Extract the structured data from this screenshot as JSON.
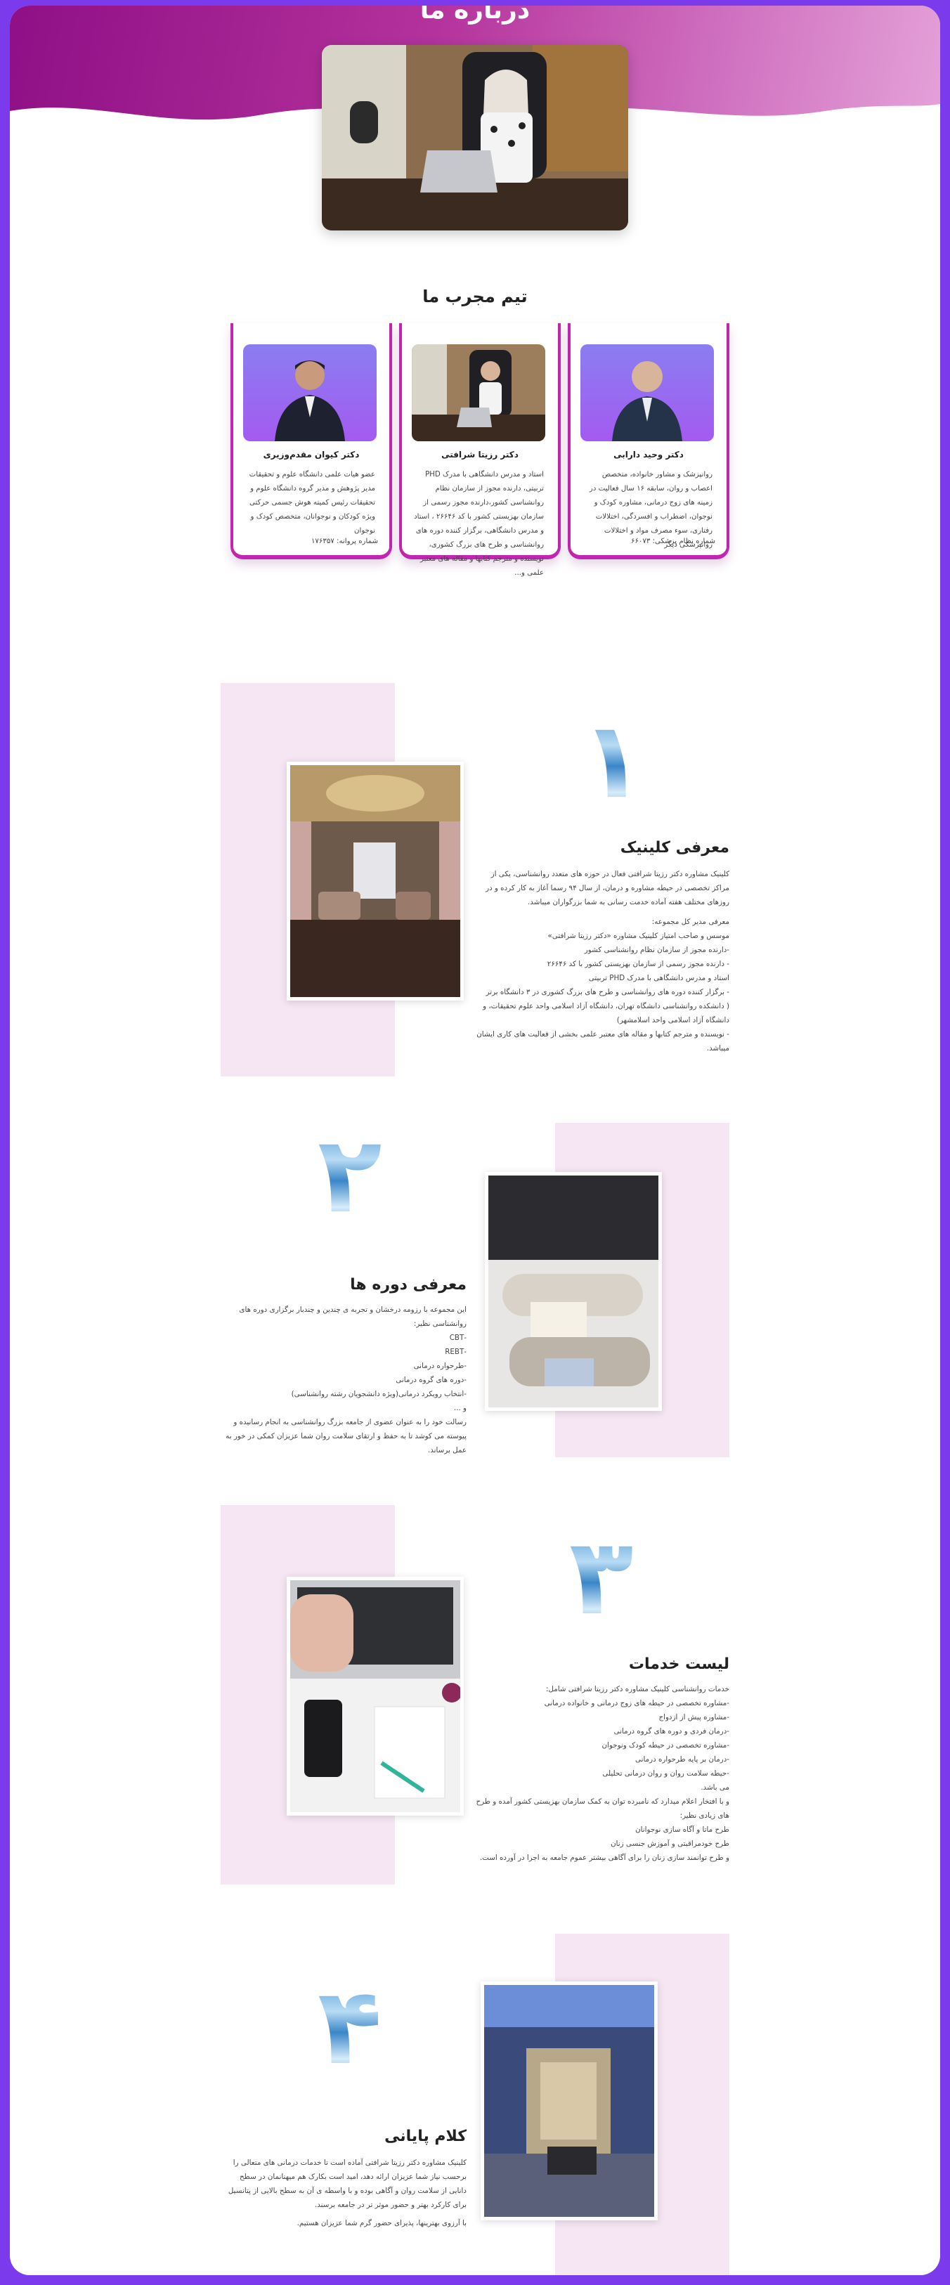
{
  "hero": {
    "title": "درباره ما"
  },
  "team": {
    "title": "تیم مجرب ما",
    "members": [
      {
        "name": "دکتر وحید دارابی",
        "bio": "روانپزشک و مشاور خانواده، متخصص اعصاب و روان، سابقه ۱۶ سال فعالیت در زمینه های زوج درمانی، مشاوره کودک و نوجوان، اضطراب و افسردگی، اختلالات رفتاری، سوء مصرف مواد و اختلالات روانپزشکی دیگر",
        "license": "شماره نظام پزشکی: ۶۶۰۷۳"
      },
      {
        "name": "دکتر رزیتا شرافتی",
        "bio": "استاد و مدرس دانشگاهی با مدرک PHD تربیتی، دارنده مجوز از سازمان نظام روانشناسی کشور،دارنده مجوز رسمی از سازمان بهزیستی کشور با کد ۲۶۶۴۶ ، استاد و مدرس دانشگاهی، برگزار کننده دوره های روانشناسی و طرح های بزرگ کشوری، نویسنده و مترجم کتابها و مقاله های معتبر علمی و...",
        "license": ""
      },
      {
        "name": "دکتر کیوان مقدم‌وزیری",
        "bio": "عضو هیات علمی دانشگاه علوم و تحقیقات مدیر پژوهش و مدیر گروه دانشگاه علوم و تحقیقات رئیس کمیته هوش جسمی حرکتی ویژه کودکان و نوجوانان، متخصص کودک و نوجوان",
        "license": "شماره پروانه: ۱۷۶۳۵۷"
      }
    ]
  },
  "sections": [
    {
      "number": "۱",
      "title": "معرفی کلینیک",
      "paragraphs": [
        "کلینیک مشاوره دکتر رزیتا شرافتی فعال در حوزه های متعدد روانشناسی، یکی از مراکز تخصصی در حیطه مشاوره و درمان، از سال ۹۴ رسما آغاز به کار کرده و در روزهای مختلف هفته آماده خدمت رسانی به شما بزرگواران میباشد.",
        "معرفی مدیر کل مجموعه:",
        "موسس و صاحب امتیاز کلینیک مشاوره «دکتر رزیتا شرافتی»",
        "-دارنده مجوز از سازمان نظام روانشناسی کشور",
        "- دارنده مجوز رسمی از سازمان بهزیستی کشور با کد ۲۶۶۴۶",
        "استاد و مدرس دانشگاهی با مدرک PHD تربیتی",
        "- برگزار کننده دوره های روانشناسی و طرح های بزرگ کشوری در ۳ دانشگاه برتر",
        "( دانشکده روانشناسی دانشگاه تهران، دانشگاه آزاد اسلامی واحد علوم تحقیقات، و دانشگاه آزاد اسلامی واحد اسلامشهر)",
        "- نویسنده و مترجم کتابها و مقاله های معتبر علمی بخشی از فعالیت های کاری ایشان میباشد."
      ]
    },
    {
      "number": "۲",
      "title": "معرفی دوره ها",
      "paragraphs": [
        "این مجموعه با رزومه درخشان و تجربه ی چندین و چندبار برگزاری دوره های روانشناسی نظیر:",
        "-CBT",
        "-REBT",
        "-طرحواره درمانی",
        "-دوره های گروه درمانی",
        "-انتخاب رویکرد درمانی(ویژه دانشجویان رشته روانشناسی)",
        "و ...",
        "رسالت خود را به عنوان عضوی از جامعه بزرگ روانشناسی به انجام رسانیده و پیوسته می کوشد تا به حفظ و ارتقای سلامت روان شما عزیزان کمکی در خور به عمل برساند."
      ]
    },
    {
      "number": "۳",
      "title": "لیست خدمات",
      "paragraphs": [
        "خدمات روانشناسی کلینیک مشاوره دکتر رزیتا شرافتی شامل:",
        "-مشاوره تخصصی در حیطه های زوج درمانی و خانواده درمانی",
        "-مشاوره پیش از ازدواج",
        "-درمان فردی و دوره های گروه درمانی",
        "-مشاوره تخصصی در حیطه کودک ونوجوان",
        "-درمان بر پایه طرحواره درمانی",
        "-حیطه سلامت روان و روان درمانی تحلیلی",
        "می باشد.",
        "و با افتخار اعلام میدارد که نامبرده توان به کمک سازمان بهزیستی کشور آمده و طرح های زیادی نظیر:",
        "طرح ماتا و آگاه سازی نوجوانان",
        "طرح خودمراقبتی و آموزش جنسی زنان",
        "و طرح توانمند سازی زنان را برای آگاهی بیشتر عموم جامعه به اجرا در آورده است."
      ]
    },
    {
      "number": "۴",
      "title": "کلام پایانی",
      "paragraphs": [
        "کلینیک مشاوره دکتر رزیتا شرافتی آماده است تا خدمات درمانی های متعالی را برحسب نیاز شما عزیزان ارائه دهد، امید است بکارک هم میهنانمان در سطح دانایی از سلامت روان و آگاهی بوده و با واسطه ی آن به سطح بالایی از پتانسیل برای کارکرد بهتر و حضور موثر تر در جامعه برسند.",
        "با آرزوی بهترینها، پذیرای حضور گرم شما عزیزان هستیم."
      ]
    }
  ]
}
